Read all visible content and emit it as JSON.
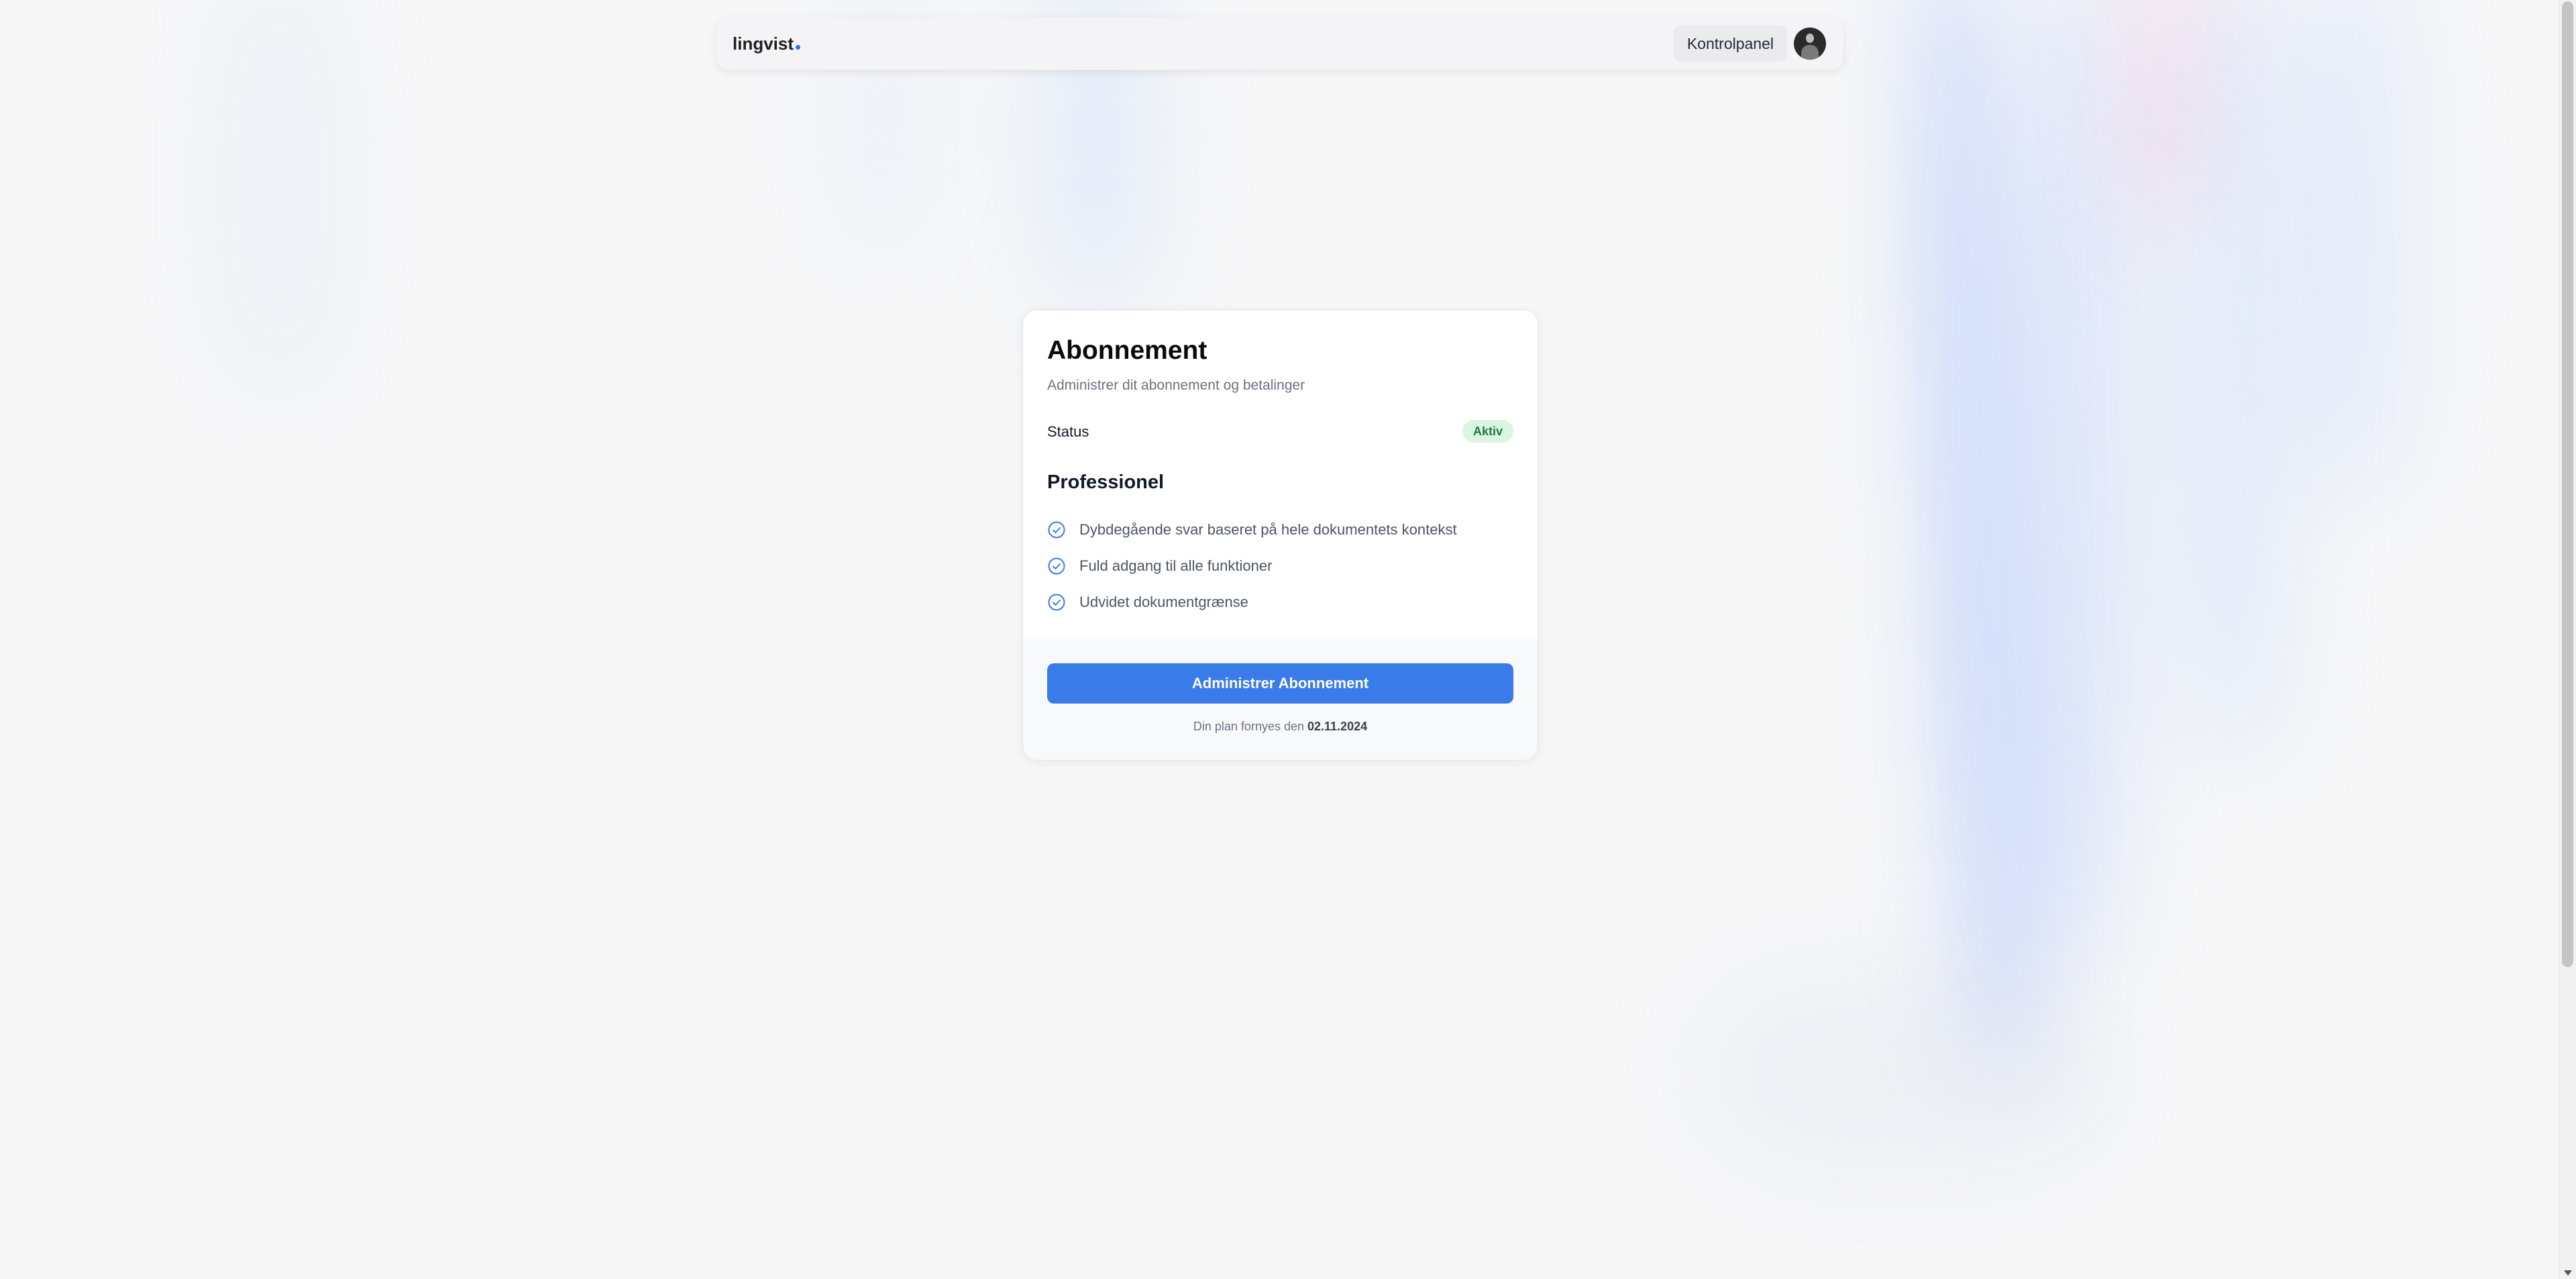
{
  "header": {
    "logo_text": "lingvist",
    "dashboard_label": "Kontrolpanel"
  },
  "subscription": {
    "title": "Abonnement",
    "subtitle": "Administrer dit abonnement og betalinger",
    "status_label": "Status",
    "status_value": "Aktiv",
    "plan_name": "Professionel",
    "features": [
      "Dybdegående svar baseret på hele dokumentets kontekst",
      "Fuld adgang til alle funktioner",
      "Udvidet dokumentgrænse"
    ],
    "manage_button_label": "Administrer Abonnement",
    "renewal_text": "Din plan fornyes den ",
    "renewal_date": "02.11.2024"
  },
  "colors": {
    "accent": "#3a7bea",
    "status_badge_bg": "#dcf5e2",
    "status_badge_text": "#15803d"
  },
  "icons": {
    "feature_icon": "check-circle-icon",
    "logo_dot": "logo-dot-icon",
    "avatar": "user-avatar"
  }
}
